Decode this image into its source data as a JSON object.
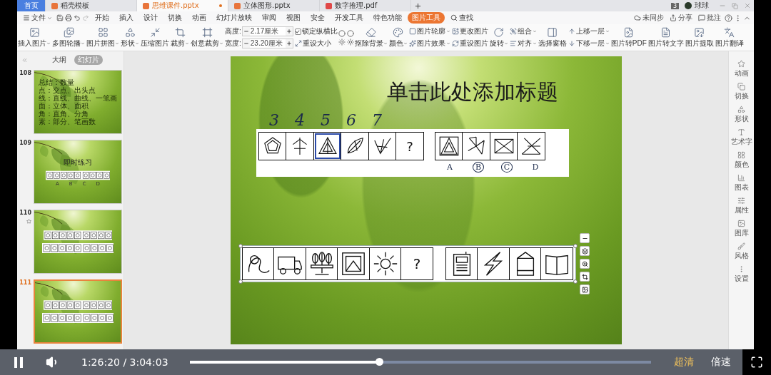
{
  "doc_tabs": [
    {
      "kind": "home",
      "label": "首页",
      "selected": false,
      "modified": false
    },
    {
      "kind": "doc",
      "label": "稻壳模板",
      "selected": false,
      "modified": false
    },
    {
      "kind": "doc",
      "label": "思维课件.pptx",
      "selected": true,
      "modified": true
    },
    {
      "kind": "doc",
      "label": "立体图形.pptx",
      "selected": false,
      "modified": false
    },
    {
      "kind": "doc",
      "label": "数字推理.pdf",
      "selected": false,
      "modified": false
    }
  ],
  "user": {
    "badge": "3",
    "name": "球球"
  },
  "menu": {
    "file": "文件",
    "items": [
      {
        "label": "开始",
        "selected": false
      },
      {
        "label": "插入",
        "selected": false
      },
      {
        "label": "设计",
        "selected": false
      },
      {
        "label": "切换",
        "selected": false
      },
      {
        "label": "动画",
        "selected": false
      },
      {
        "label": "幻灯片放映",
        "selected": false
      },
      {
        "label": "审阅",
        "selected": false
      },
      {
        "label": "视图",
        "selected": false
      },
      {
        "label": "安全",
        "selected": false
      },
      {
        "label": "开发工具",
        "selected": false
      },
      {
        "label": "特色功能",
        "selected": false
      },
      {
        "label": "图片工具",
        "selected": true
      }
    ],
    "search": "查找",
    "actions": [
      "未同步",
      "分享",
      "批注"
    ]
  },
  "ribbon": [
    {
      "kind": "big",
      "label": "插入图片",
      "menu": true
    },
    {
      "kind": "big",
      "label": "多图轮播",
      "menu": true
    },
    {
      "kind": "big",
      "label": "图片拼图",
      "menu": true
    },
    {
      "kind": "big",
      "label": "形状",
      "menu": true
    },
    {
      "kind": "big",
      "label": "压缩图片",
      "menu": false
    },
    {
      "kind": "big",
      "label": "裁剪",
      "menu": true
    },
    {
      "kind": "big",
      "label": "创意裁剪",
      "menu": true
    },
    {
      "kind": "size",
      "fields": [
        {
          "label": "高度:",
          "value": "2.17厘米"
        },
        {
          "label": "宽度:",
          "value": "23.20厘米"
        }
      ]
    },
    {
      "kind": "pair",
      "items": [
        {
          "label": "锁定纵横比",
          "checked": true
        },
        {
          "label": "重设大小",
          "menu": false
        }
      ]
    },
    {
      "kind": "icons"
    },
    {
      "kind": "big",
      "label": "抠除背景",
      "menu": true
    },
    {
      "kind": "big",
      "label": "颜色",
      "menu": true
    },
    {
      "kind": "pair",
      "items": [
        {
          "label": "图片轮廓",
          "menu": true
        },
        {
          "label": "图片效果",
          "menu": true
        }
      ]
    },
    {
      "kind": "pair",
      "items": [
        {
          "label": "更改图片",
          "menu": false
        },
        {
          "label": "重设图片",
          "menu": false
        }
      ]
    },
    {
      "kind": "big",
      "label": "旋转",
      "menu": true
    },
    {
      "kind": "pair",
      "items": [
        {
          "label": "组合",
          "menu": true
        },
        {
          "label": "对齐",
          "menu": true
        }
      ]
    },
    {
      "kind": "big",
      "label": "选择窗格",
      "menu": false
    },
    {
      "kind": "pair",
      "items": [
        {
          "label": "上移一层",
          "menu": true
        },
        {
          "label": "下移一层",
          "menu": true
        }
      ]
    },
    {
      "kind": "big",
      "label": "图片转PDF",
      "menu": false
    },
    {
      "kind": "big",
      "label": "图片转文字",
      "menu": false
    },
    {
      "kind": "big",
      "label": "图片提取",
      "menu": false
    },
    {
      "kind": "big",
      "label": "图片翻译",
      "menu": false
    }
  ],
  "panel": {
    "tabs": [
      {
        "label": "大纲",
        "selected": false
      },
      {
        "label": "幻灯片",
        "selected": true
      }
    ],
    "slides": [
      {
        "number": "108",
        "kind": "text",
        "selected": false,
        "starred": false,
        "lines": [
          "总结：数量",
          "点：交点、出头点",
          "线：直线、曲线、一笔画",
          "面：立体、面积",
          "角：直角、分角",
          "素：部分、笔画数"
        ]
      },
      {
        "number": "109",
        "kind": "exercise",
        "selected": false,
        "starred": false,
        "title": "即时练习",
        "options": [
          "A",
          "B",
          "C",
          "D"
        ]
      },
      {
        "number": "110",
        "kind": "rows",
        "selected": false,
        "starred": true
      },
      {
        "number": "111",
        "kind": "rows",
        "selected": true,
        "starred": false
      }
    ]
  },
  "slide": {
    "title": "单击此处添加标题",
    "annotations": [
      "3",
      "4",
      "5",
      "6",
      "7"
    ],
    "row_1": {
      "cells": [
        {
          "kind": "figure",
          "marked": false
        },
        {
          "kind": "figure",
          "marked": false
        },
        {
          "kind": "figure",
          "marked": true
        },
        {
          "kind": "figure",
          "marked": false
        },
        {
          "kind": "figure",
          "marked": false
        },
        {
          "kind": "question",
          "text": "?",
          "marked": false
        }
      ],
      "options": [
        {
          "label": "A",
          "circled": false
        },
        {
          "label": "B",
          "circled": true
        },
        {
          "label": "C",
          "circled": true
        },
        {
          "label": "D",
          "circled": false
        }
      ]
    },
    "row_2": {
      "selected": true,
      "cells": [
        {
          "kind": "figure"
        },
        {
          "kind": "figure"
        },
        {
          "kind": "figure"
        },
        {
          "kind": "figure"
        },
        {
          "kind": "figure"
        },
        {
          "kind": "question",
          "text": "?"
        }
      ],
      "options": [
        {
          "kind": "figure"
        },
        {
          "kind": "figure"
        },
        {
          "kind": "figure"
        },
        {
          "kind": "figure"
        }
      ]
    }
  },
  "sidebar": [
    "动画",
    "切换",
    "形状",
    "艺术字",
    "颜色",
    "图表",
    "属性",
    "图库",
    "风格",
    "设置"
  ],
  "player": {
    "playing": true,
    "time": "1:26:20 / 3:04:03",
    "level": 0.41,
    "quality": "超清",
    "speed": "倍速"
  }
}
